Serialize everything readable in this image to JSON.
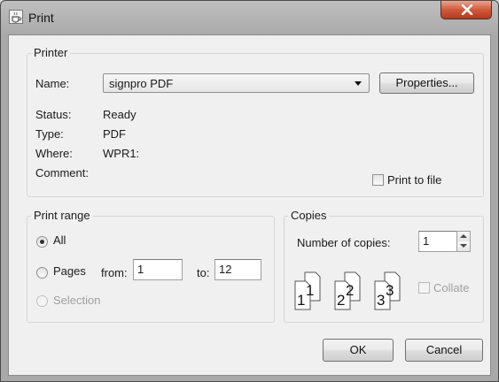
{
  "window": {
    "title": "Print",
    "close_glyph": "x"
  },
  "printer": {
    "legend": "Printer",
    "name_label": "Name:",
    "name_value": "signpro PDF",
    "properties_button": "Properties...",
    "status_label": "Status:",
    "status_value": "Ready",
    "type_label": "Type:",
    "type_value": "PDF",
    "where_label": "Where:",
    "where_value": "WPR1:",
    "comment_label": "Comment:",
    "comment_value": "",
    "print_to_file_label": "Print to file",
    "print_to_file_checked": false
  },
  "print_range": {
    "legend": "Print range",
    "all_label": "All",
    "pages_label": "Pages",
    "from_label": "from:",
    "from_value": "1",
    "to_label": "to:",
    "to_value": "12",
    "selection_label": "Selection",
    "selected": "all"
  },
  "copies": {
    "legend": "Copies",
    "number_label": "Number of copies:",
    "number_value": "1",
    "collate_label": "Collate",
    "collate_checked": false,
    "collate_pages": [
      "1",
      "1",
      "2",
      "2",
      "3",
      "3"
    ]
  },
  "buttons": {
    "ok": "OK",
    "cancel": "Cancel"
  },
  "colors": {
    "close_button": "#c94a2c",
    "window_frame": "#a9a9a9",
    "dialog_bg": "#f0f0f0"
  },
  "icons": {
    "title": "java-cup-icon",
    "close": "close-icon"
  }
}
